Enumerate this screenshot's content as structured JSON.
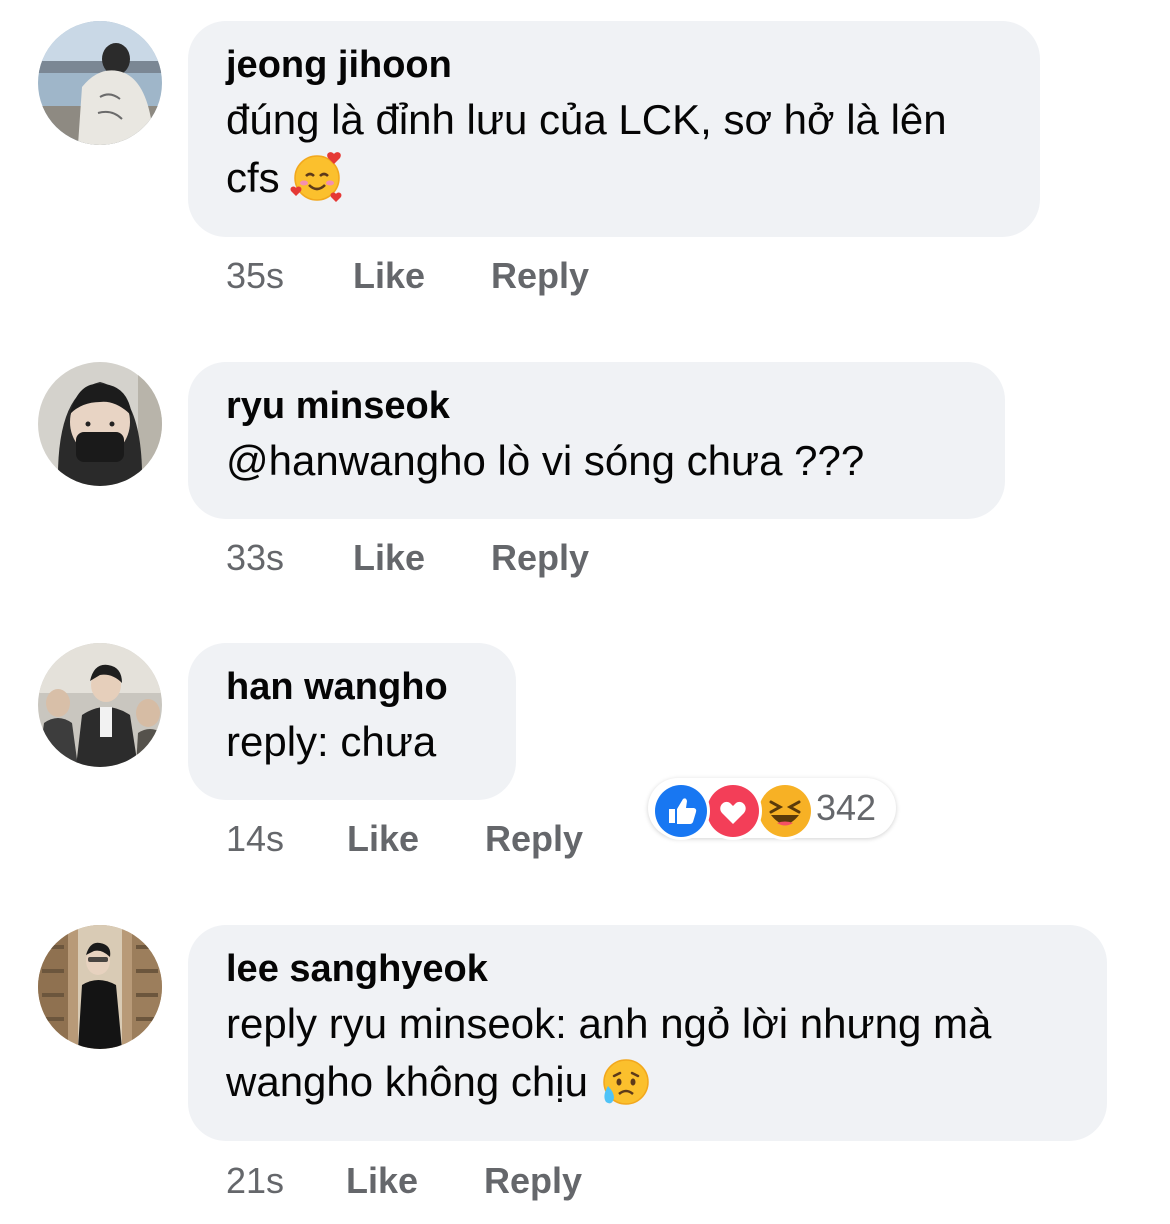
{
  "comments": [
    {
      "author": "jeong jihoon",
      "text": "đúng là đỉnh lưu của LCK, sơ hở là lên cfs",
      "emoji": "smiling-face-with-hearts",
      "time": "35s",
      "like_label": "Like",
      "reply_label": "Reply"
    },
    {
      "author": "ryu minseok",
      "text": "@hanwangho lò vi sóng chưa ???",
      "time": "33s",
      "like_label": "Like",
      "reply_label": "Reply"
    },
    {
      "author": "han wangho",
      "text": "reply: chưa",
      "time": "14s",
      "like_label": "Like",
      "reply_label": "Reply",
      "reactions": {
        "icons": [
          "like-reaction",
          "love-reaction",
          "haha-reaction"
        ],
        "count": "342"
      }
    },
    {
      "author": "lee sanghyeok",
      "text": "reply ryu minseok: anh ngỏ lời nhưng mà wangho không chịu",
      "emoji": "sad-but-relieved-face",
      "time": "21s",
      "like_label": "Like",
      "reply_label": "Reply"
    }
  ],
  "colors": {
    "bubble": "#f0f2f5",
    "meta_text": "#65676b",
    "like_blue": "#1877f2",
    "love_red": "#f33e58",
    "haha_yellow": "#f7b125"
  }
}
